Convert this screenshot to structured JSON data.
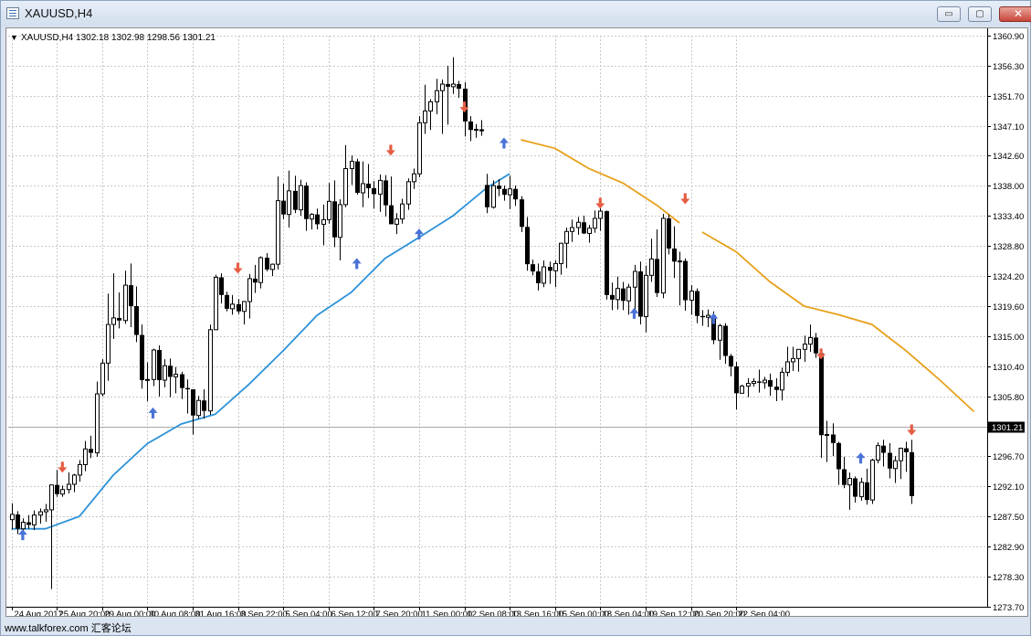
{
  "window": {
    "title": "XAUUSD,H4",
    "minimize_label": "▭",
    "restore_label": "▢",
    "close_label": "✕"
  },
  "chart_info": {
    "arrow": "▼",
    "text": "XAUUSD,H4  1302.18 1302.98 1298.56 1301.21"
  },
  "watermark": "www.talkforex.com 汇客论坛",
  "colors": {
    "up_arrow": "#4a72d6",
    "down_arrow": "#e55d44",
    "ma_blue": "#2f92d8",
    "ma_orange": "#e8a01a",
    "grid": "#c9c9c9"
  },
  "chart_data": {
    "type": "candlestick",
    "symbol": "XAUUSD",
    "timeframe": "H4",
    "ylim": [
      1273.7,
      1360.9
    ],
    "y_ticks": [
      "1360.90",
      "1356.30",
      "1351.70",
      "1347.10",
      "1342.60",
      "1338.00",
      "1333.40",
      "1328.80",
      "1324.20",
      "1319.60",
      "1315.00",
      "1310.40",
      "1305.80",
      "1301.21",
      "1296.70",
      "1292.10",
      "1287.50",
      "1282.90",
      "1278.30",
      "1273.70"
    ],
    "y_tick_values": [
      1360.9,
      1356.3,
      1351.7,
      1347.1,
      1342.6,
      1338.0,
      1333.4,
      1328.8,
      1324.2,
      1319.6,
      1315.0,
      1310.4,
      1305.8,
      1301.21,
      1296.7,
      1292.1,
      1287.5,
      1282.9,
      1278.3,
      1273.7
    ],
    "current_price": "1301.21",
    "current_price_value": 1301.21,
    "x_labels": [
      "24 Aug 2017",
      "25 Aug 20:00",
      "29 Aug 00:00",
      "30 Aug 08:00",
      "31 Aug 16:00",
      "3 Sep 22:00",
      "5 Sep 04:00",
      "6 Sep 12:00",
      "7 Sep 20:00",
      "11 Sep 00:00",
      "12 Sep 08:00",
      "13 Sep 16:00",
      "15 Sep 00:00",
      "18 Sep 04:00",
      "19 Sep 12:00",
      "20 Sep 20:00",
      "22 Sep 04:00"
    ],
    "x_label_bars": [
      0,
      8,
      16,
      24,
      32,
      40,
      48,
      56,
      64,
      72,
      80,
      88,
      96,
      104,
      112,
      120,
      128
    ],
    "bars": [
      [
        1287.0,
        1289.5,
        1285.5,
        1287.8
      ],
      [
        1287.8,
        1288.3,
        1284.8,
        1285.6
      ],
      [
        1285.6,
        1287.2,
        1284.9,
        1286.6
      ],
      [
        1286.6,
        1287.7,
        1285.6,
        1286.2
      ],
      [
        1286.2,
        1288.4,
        1285.4,
        1287.7
      ],
      [
        1287.7,
        1288.7,
        1286.4,
        1288.2
      ],
      [
        1288.2,
        1289.4,
        1286.7,
        1288.5
      ],
      [
        1288.5,
        1291.6,
        1276.4,
        1292.3
      ],
      [
        1292.3,
        1294.6,
        1290.5,
        1290.9
      ],
      [
        1290.9,
        1292.2,
        1290.5,
        1291.6
      ],
      [
        1291.6,
        1294.2,
        1291.0,
        1292.4
      ],
      [
        1292.4,
        1294.0,
        1291.2,
        1293.8
      ],
      [
        1293.8,
        1296.1,
        1292.8,
        1295.4
      ],
      [
        1295.4,
        1299.0,
        1294.4,
        1297.8
      ],
      [
        1297.8,
        1299.8,
        1296.4,
        1297.2
      ],
      [
        1297.2,
        1308.1,
        1296.6,
        1306.2
      ],
      [
        1306.2,
        1311.5,
        1305.8,
        1310.9
      ],
      [
        1310.9,
        1321.5,
        1308.2,
        1316.8
      ],
      [
        1316.8,
        1324.6,
        1314.6,
        1317.8
      ],
      [
        1317.8,
        1321.7,
        1316.2,
        1317.4
      ],
      [
        1317.4,
        1325.0,
        1316.9,
        1322.8
      ],
      [
        1322.8,
        1326.1,
        1316.4,
        1319.6
      ],
      [
        1319.6,
        1322.6,
        1314.1,
        1315.2
      ],
      [
        1315.2,
        1316.8,
        1307.0,
        1308.3
      ],
      [
        1308.3,
        1311.0,
        1305.1,
        1308.4
      ],
      [
        1308.4,
        1313.1,
        1307.4,
        1312.9
      ],
      [
        1312.9,
        1313.6,
        1305.8,
        1308.3
      ],
      [
        1308.3,
        1311.5,
        1307.2,
        1310.5
      ],
      [
        1310.5,
        1311.6,
        1305.7,
        1308.8
      ],
      [
        1308.8,
        1310.3,
        1306.3,
        1309.2
      ],
      [
        1309.2,
        1309.6,
        1305.4,
        1307.1
      ],
      [
        1307.1,
        1308.4,
        1303.2,
        1306.9
      ],
      [
        1306.9,
        1306.9,
        1300.0,
        1302.9
      ],
      [
        1302.9,
        1305.9,
        1302.4,
        1305.2
      ],
      [
        1305.2,
        1306.9,
        1302.4,
        1303.6
      ],
      [
        1303.6,
        1316.8,
        1303.0,
        1316.0
      ],
      [
        1316.0,
        1324.4,
        1316.0,
        1324.0
      ],
      [
        1324.0,
        1324.6,
        1320.0,
        1321.3
      ],
      [
        1321.3,
        1321.8,
        1318.8,
        1319.2
      ],
      [
        1319.2,
        1321.3,
        1318.3,
        1319.9
      ],
      [
        1319.9,
        1320.7,
        1318.4,
        1318.8
      ],
      [
        1318.8,
        1320.4,
        1316.8,
        1320.3
      ],
      [
        1320.3,
        1324.5,
        1317.7,
        1323.8
      ],
      [
        1323.8,
        1325.9,
        1321.6,
        1323.2
      ],
      [
        1323.2,
        1327.2,
        1322.3,
        1327.0
      ],
      [
        1327.0,
        1327.7,
        1324.9,
        1325.2
      ],
      [
        1325.2,
        1326.1,
        1324.2,
        1326.0
      ],
      [
        1326.0,
        1339.4,
        1325.2,
        1335.7
      ],
      [
        1335.7,
        1338.3,
        1332.9,
        1333.6
      ],
      [
        1333.6,
        1340.3,
        1331.6,
        1337.2
      ],
      [
        1337.2,
        1339.5,
        1333.8,
        1334.3
      ],
      [
        1334.3,
        1338.9,
        1333.4,
        1338.0
      ],
      [
        1338.0,
        1338.5,
        1331.1,
        1332.9
      ],
      [
        1332.9,
        1333.8,
        1331.3,
        1333.6
      ],
      [
        1333.6,
        1334.5,
        1331.3,
        1332.1
      ],
      [
        1332.1,
        1335.1,
        1328.9,
        1332.8
      ],
      [
        1332.8,
        1338.4,
        1332.2,
        1335.6
      ],
      [
        1335.6,
        1338.8,
        1328.6,
        1330.1
      ],
      [
        1330.1,
        1335.9,
        1326.6,
        1335.1
      ],
      [
        1335.1,
        1344.2,
        1334.7,
        1340.6
      ],
      [
        1340.6,
        1342.6,
        1338.1,
        1341.7
      ],
      [
        1341.7,
        1342.1,
        1336.6,
        1336.9
      ],
      [
        1336.9,
        1341.7,
        1334.7,
        1338.3
      ],
      [
        1338.3,
        1341.3,
        1336.1,
        1337.6
      ],
      [
        1337.6,
        1338.7,
        1334.5,
        1336.7
      ],
      [
        1336.7,
        1339.7,
        1334.0,
        1338.8
      ],
      [
        1338.8,
        1339.6,
        1333.3,
        1335.0
      ],
      [
        1335.0,
        1339.4,
        1333.8,
        1332.1
      ],
      [
        1332.1,
        1333.8,
        1330.6,
        1332.9
      ],
      [
        1332.9,
        1336.0,
        1332.2,
        1335.2
      ],
      [
        1335.2,
        1339.1,
        1334.3,
        1338.6
      ],
      [
        1338.6,
        1340.6,
        1337.5,
        1339.8
      ],
      [
        1339.8,
        1348.6,
        1339.3,
        1347.6
      ],
      [
        1347.6,
        1353.4,
        1345.9,
        1349.4
      ],
      [
        1349.4,
        1351.2,
        1346.5,
        1350.8
      ],
      [
        1350.8,
        1354.3,
        1348.9,
        1352.5
      ],
      [
        1352.5,
        1354.2,
        1345.9,
        1353.5
      ],
      [
        1353.5,
        1356.3,
        1347.3,
        1353.1
      ],
      [
        1353.1,
        1357.6,
        1352.0,
        1353.5
      ],
      [
        1353.5,
        1354.0,
        1351.4,
        1352.8
      ],
      [
        1352.8,
        1353.8,
        1345.5,
        1347.8
      ],
      [
        1347.8,
        1348.6,
        1344.8,
        1346.5
      ],
      [
        1346.5,
        1347.4,
        1345.3,
        1346.6
      ],
      [
        1346.6,
        1348.0,
        1345.6,
        1346.3
      ],
      [
        1338.1,
        1339.8,
        1333.8,
        1334.7
      ],
      [
        1334.7,
        1338.8,
        1334.5,
        1338.0
      ],
      [
        1338.0,
        1339.0,
        1336.4,
        1337.5
      ],
      [
        1337.5,
        1338.0,
        1335.7,
        1336.6
      ],
      [
        1336.6,
        1339.5,
        1334.4,
        1337.5
      ],
      [
        1337.5,
        1338.0,
        1334.9,
        1335.9
      ],
      [
        1335.9,
        1336.4,
        1330.9,
        1331.7
      ],
      [
        1331.7,
        1333.2,
        1325.0,
        1326.0
      ],
      [
        1326.0,
        1326.7,
        1324.3,
        1324.9
      ],
      [
        1324.9,
        1326.1,
        1322.0,
        1323.1
      ],
      [
        1323.1,
        1326.6,
        1322.5,
        1325.6
      ],
      [
        1325.6,
        1326.4,
        1323.0,
        1325.0
      ],
      [
        1325.0,
        1326.6,
        1322.5,
        1326.1
      ],
      [
        1326.1,
        1329.3,
        1324.4,
        1329.2
      ],
      [
        1329.2,
        1331.6,
        1325.4,
        1331.0
      ],
      [
        1331.0,
        1332.8,
        1329.4,
        1331.6
      ],
      [
        1331.6,
        1333.2,
        1330.5,
        1332.4
      ],
      [
        1332.4,
        1333.4,
        1330.6,
        1330.7
      ],
      [
        1330.7,
        1332.0,
        1329.3,
        1331.5
      ],
      [
        1331.5,
        1334.2,
        1330.8,
        1333.0
      ],
      [
        1333.0,
        1335.0,
        1331.1,
        1334.1
      ],
      [
        1334.1,
        1334.2,
        1320.6,
        1321.3
      ],
      [
        1321.3,
        1323.2,
        1319.0,
        1320.6
      ],
      [
        1320.6,
        1324.1,
        1319.1,
        1322.3
      ],
      [
        1322.3,
        1323.3,
        1319.0,
        1320.4
      ],
      [
        1320.4,
        1323.0,
        1318.3,
        1322.5
      ],
      [
        1322.5,
        1325.9,
        1318.6,
        1324.9
      ],
      [
        1324.9,
        1326.4,
        1316.8,
        1318.0
      ],
      [
        1318.0,
        1325.8,
        1315.6,
        1324.3
      ],
      [
        1324.3,
        1329.9,
        1323.3,
        1326.8
      ],
      [
        1326.8,
        1331.3,
        1321.0,
        1321.6
      ],
      [
        1321.6,
        1333.7,
        1320.8,
        1333.0
      ],
      [
        1333.0,
        1333.6,
        1327.5,
        1328.4
      ],
      [
        1328.4,
        1331.8,
        1323.9,
        1326.4
      ],
      [
        1326.4,
        1327.9,
        1319.7,
        1326.5
      ],
      [
        1326.5,
        1326.9,
        1318.9,
        1320.5
      ],
      [
        1320.5,
        1322.8,
        1318.3,
        1321.9
      ],
      [
        1321.9,
        1322.3,
        1317.0,
        1318.1
      ],
      [
        1318.1,
        1319.0,
        1316.6,
        1317.9
      ],
      [
        1317.9,
        1319.1,
        1316.4,
        1318.2
      ],
      [
        1318.2,
        1318.8,
        1313.8,
        1314.4
      ],
      [
        1314.4,
        1316.9,
        1311.4,
        1316.6
      ],
      [
        1316.6,
        1317.0,
        1310.8,
        1312.0
      ],
      [
        1312.0,
        1312.3,
        1308.9,
        1310.4
      ],
      [
        1310.4,
        1311.1,
        1303.8,
        1306.3
      ],
      [
        1306.3,
        1307.6,
        1306.8,
        1307.4
      ],
      [
        1307.4,
        1308.6,
        1305.7,
        1307.8
      ],
      [
        1307.8,
        1308.6,
        1307.3,
        1308.1
      ],
      [
        1308.1,
        1309.9,
        1306.4,
        1307.9
      ],
      [
        1307.9,
        1308.8,
        1307.0,
        1308.3
      ],
      [
        1308.3,
        1309.3,
        1305.9,
        1307.3
      ],
      [
        1307.3,
        1308.6,
        1305.1,
        1306.8
      ],
      [
        1306.8,
        1310.2,
        1305.2,
        1309.5
      ],
      [
        1309.5,
        1313.4,
        1308.9,
        1311.1
      ],
      [
        1311.1,
        1313.4,
        1309.7,
        1311.6
      ],
      [
        1311.6,
        1312.5,
        1309.6,
        1313.0
      ],
      [
        1313.0,
        1315.1,
        1311.1,
        1313.8
      ],
      [
        1313.8,
        1316.8,
        1312.6,
        1314.8
      ],
      [
        1314.8,
        1315.5,
        1311.7,
        1312.4
      ],
      [
        1312.4,
        1313.1,
        1296.4,
        1299.9
      ],
      [
        1299.9,
        1302.1,
        1295.8,
        1300.0
      ],
      [
        1300.0,
        1301.7,
        1296.7,
        1298.7
      ],
      [
        1298.7,
        1298.9,
        1292.3,
        1294.7
      ],
      [
        1294.7,
        1296.6,
        1291.8,
        1292.3
      ],
      [
        1292.3,
        1294.2,
        1288.5,
        1293.3
      ],
      [
        1293.3,
        1293.6,
        1289.6,
        1290.5
      ],
      [
        1290.5,
        1293.4,
        1289.9,
        1292.7
      ],
      [
        1292.7,
        1294.8,
        1289.3,
        1290.0
      ],
      [
        1290.0,
        1296.3,
        1289.4,
        1296.1
      ],
      [
        1296.1,
        1298.8,
        1295.6,
        1298.3
      ],
      [
        1298.3,
        1299.2,
        1295.1,
        1297.2
      ],
      [
        1297.2,
        1298.7,
        1293.3,
        1294.8
      ],
      [
        1294.8,
        1296.7,
        1292.6,
        1296.0
      ],
      [
        1296.0,
        1298.0,
        1293.2,
        1297.9
      ],
      [
        1297.9,
        1298.9,
        1294.3,
        1297.3
      ],
      [
        1297.3,
        1299.2,
        1289.4,
        1290.6
      ]
    ],
    "ma_blue": [
      [
        0,
        1285.6
      ],
      [
        6,
        1285.6
      ],
      [
        12,
        1287.5
      ],
      [
        18,
        1293.8
      ],
      [
        24,
        1298.6
      ],
      [
        30,
        1301.6
      ],
      [
        36,
        1303.1
      ],
      [
        42,
        1307.7
      ],
      [
        48,
        1312.8
      ],
      [
        54,
        1318.2
      ],
      [
        60,
        1321.7
      ],
      [
        66,
        1326.9
      ],
      [
        72,
        1330.1
      ],
      [
        78,
        1333.4
      ],
      [
        84,
        1337.7
      ],
      [
        88,
        1339.8
      ]
    ],
    "ma_orange_1": [
      [
        90,
        1345.0
      ],
      [
        96,
        1343.7
      ],
      [
        102,
        1340.6
      ],
      [
        108,
        1338.4
      ],
      [
        114,
        1335.0
      ],
      [
        118,
        1332.3
      ]
    ],
    "ma_orange_2": [
      [
        122,
        1330.9
      ],
      [
        128,
        1327.9
      ],
      [
        134,
        1323.3
      ],
      [
        140,
        1319.6
      ],
      [
        146,
        1318.3
      ],
      [
        152,
        1316.8
      ],
      [
        158,
        1312.8
      ],
      [
        164,
        1308.3
      ],
      [
        170,
        1303.5
      ]
    ],
    "arrows_up": [
      [
        2,
        1284.7
      ],
      [
        25,
        1303.3
      ],
      [
        61,
        1326.1
      ],
      [
        72,
        1330.6
      ],
      [
        87,
        1344.5
      ],
      [
        110,
        1318.5
      ],
      [
        124,
        1317.7
      ],
      [
        150,
        1296.4
      ]
    ],
    "arrows_down": [
      [
        9,
        1295.0
      ],
      [
        40,
        1325.4
      ],
      [
        67,
        1343.4
      ],
      [
        80,
        1350.0
      ],
      [
        104,
        1335.3
      ],
      [
        119,
        1336.0
      ],
      [
        143,
        1312.3
      ],
      [
        159,
        1300.7
      ]
    ]
  }
}
